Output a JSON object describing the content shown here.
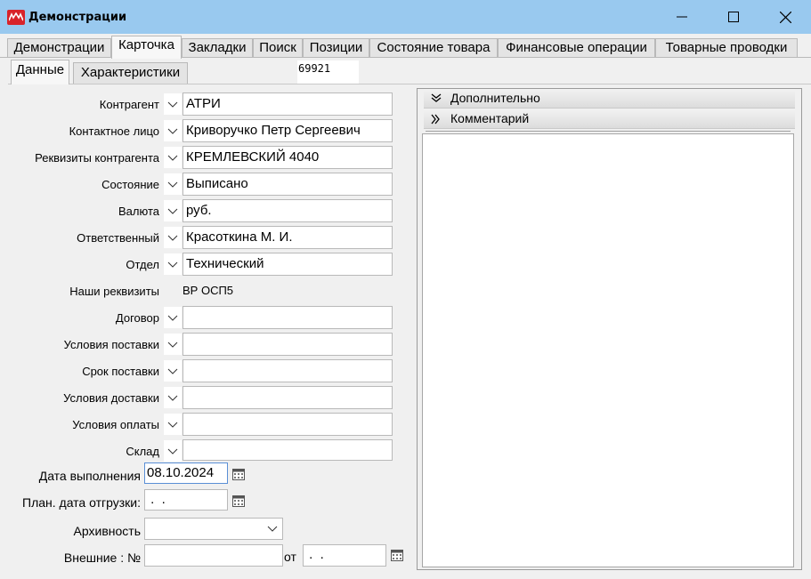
{
  "window": {
    "title": "Демонстрации"
  },
  "tabs": [
    "Демонстрации",
    "Карточка",
    "Закладки",
    "Поиск",
    "Позиции",
    "Состояние товара",
    "Финансовые операции",
    "Товарные проводки"
  ],
  "active_tab": "Карточка",
  "subtabs": [
    "Данные",
    "Характеристики"
  ],
  "active_subtab": "Данные",
  "doc_number": "69921",
  "fields": [
    {
      "label": "Контрагент",
      "value": "АТРИ"
    },
    {
      "label": "Контактное лицо",
      "value": "Криворучко Петр Сергеевич"
    },
    {
      "label": "Реквизиты контрагента",
      "value": "КРЕМЛЕВСКИЙ 4040"
    },
    {
      "label": "Состояние",
      "value": "Выписано"
    },
    {
      "label": "Валюта",
      "value": "руб."
    },
    {
      "label": "Ответственный",
      "value": "Красоткина М. И."
    },
    {
      "label": "Отдел",
      "value": "Технический"
    },
    {
      "label": "Наши реквизиты",
      "value": "ВР ОСП5"
    },
    {
      "label": "Договор",
      "value": ""
    },
    {
      "label": "Условия поставки",
      "value": ""
    },
    {
      "label": "Срок поставки",
      "value": ""
    },
    {
      "label": "Условия доставки",
      "value": ""
    },
    {
      "label": "Условия оплаты",
      "value": ""
    },
    {
      "label": "Склад",
      "value": ""
    }
  ],
  "dates": {
    "exec_label": "Дата выполнения",
    "exec_value": "08.10.2024",
    "ship_label": "План. дата отгрузки:",
    "ship_value": " .  ."
  },
  "archive": {
    "label": "Архивность",
    "value": ""
  },
  "external": {
    "label": "Внешние : №",
    "number": "",
    "from_label": "от",
    "date": " .  ."
  },
  "right_panel": {
    "sections": [
      "Дополнительно",
      "Комментарий"
    ]
  },
  "colors": {
    "titlebar": "#99c9ef",
    "logo": "#d8232a"
  }
}
